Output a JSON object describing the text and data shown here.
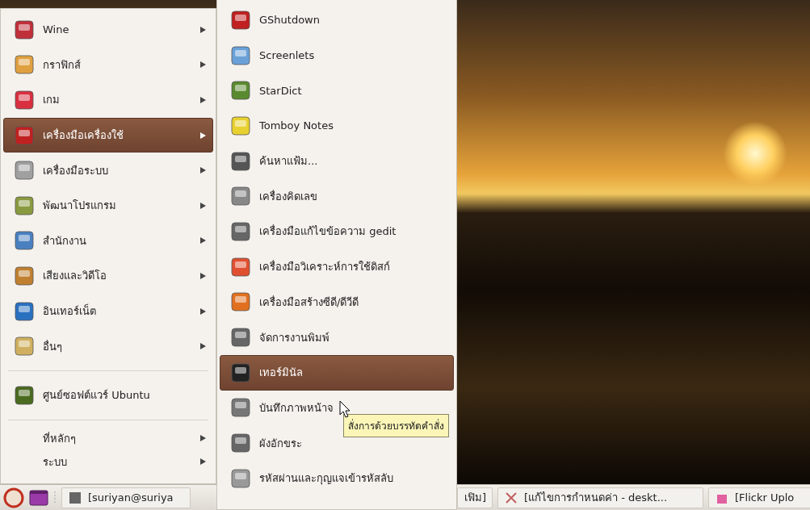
{
  "main_menu": {
    "items": [
      {
        "kind": "app",
        "label": "Wine",
        "selected": false,
        "submenu": true
      },
      {
        "kind": "app",
        "label": "กราฟิกส์",
        "selected": false,
        "submenu": true
      },
      {
        "kind": "app",
        "label": "เกม",
        "selected": false,
        "submenu": true
      },
      {
        "kind": "app",
        "label": "เครื่องมือเครื่องใช้",
        "selected": true,
        "submenu": true
      },
      {
        "kind": "app",
        "label": "เครื่องมือระบบ",
        "selected": false,
        "submenu": true
      },
      {
        "kind": "app",
        "label": "พัฒนาโปรแกรม",
        "selected": false,
        "submenu": true
      },
      {
        "kind": "app",
        "label": "สำนักงาน",
        "selected": false,
        "submenu": true
      },
      {
        "kind": "app",
        "label": "เสียงและวิดีโอ",
        "selected": false,
        "submenu": true
      },
      {
        "kind": "app",
        "label": "อินเทอร์เน็ต",
        "selected": false,
        "submenu": true
      },
      {
        "kind": "app",
        "label": "อื่นๆ",
        "selected": false,
        "submenu": true
      },
      {
        "kind": "separator"
      },
      {
        "kind": "app",
        "label": "ศูนย์ซอฟต์แวร์ Ubuntu",
        "selected": false,
        "submenu": false
      },
      {
        "kind": "separator"
      },
      {
        "kind": "plain",
        "label": "ที่หลักๆ",
        "selected": false,
        "submenu": true
      },
      {
        "kind": "plain",
        "label": "ระบบ",
        "selected": false,
        "submenu": true
      }
    ]
  },
  "submenu": {
    "items": [
      {
        "label": "GShutdown",
        "selected": false
      },
      {
        "label": "Screenlets",
        "selected": false
      },
      {
        "label": "StarDict",
        "selected": false
      },
      {
        "label": "Tomboy Notes",
        "selected": false
      },
      {
        "label": "ค้นหาแฟ้ม...",
        "selected": false
      },
      {
        "label": "เครื่องคิดเลข",
        "selected": false
      },
      {
        "label": "เครื่องมือแก้ไขข้อความ gedit",
        "selected": false
      },
      {
        "label": "เครื่องมือวิเคราะห์การใช้ดิสก์",
        "selected": false
      },
      {
        "label": "เครื่องมือสร้างซีดี/ดีวีดี",
        "selected": false
      },
      {
        "label": "จัดการงานพิมพ์",
        "selected": false
      },
      {
        "label": "เทอร์มินัล",
        "selected": true
      },
      {
        "label": "บันทึกภาพหน้าจ",
        "selected": false
      },
      {
        "label": "ผังอักขระ",
        "selected": false
      },
      {
        "label": "รหัสผ่านและกุญแจเข้ารหัสลับ",
        "selected": false
      }
    ]
  },
  "tooltip": "สั่งการด้วยบรรทัดคำสั่ง",
  "taskbar": {
    "tasks": [
      "[suriyan@suriya",
      "เฟิม]",
      "[แก้ไขการกำหนดค่า - deskt...",
      "[Flickr Uplo"
    ]
  }
}
